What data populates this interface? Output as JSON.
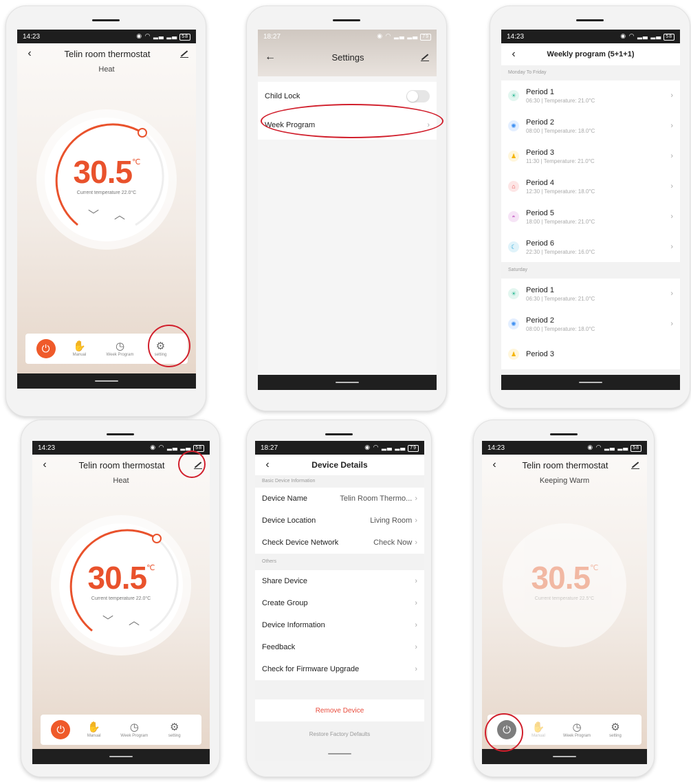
{
  "accent": "#ef5a2a",
  "highlight_color": "#d11f2c",
  "screen1": {
    "time": "14:23",
    "battery": "58",
    "title": "Telin room thermostat",
    "mode": "Heat",
    "temperature": "30.5",
    "unit": "℃",
    "current_temp": "Current temperature 22.0°C",
    "nav": [
      "Manual",
      "Week Program",
      "setting"
    ]
  },
  "screen2": {
    "time": "18:27",
    "battery": "79",
    "title": "Settings",
    "rows": [
      "Child Lock",
      "Week Program"
    ]
  },
  "screen3": {
    "time": "14:23",
    "battery": "58",
    "title": "Weekly program (5+1+1)",
    "sections": [
      {
        "label": "Monday To Friday",
        "periods": [
          {
            "name": "Period 1",
            "detail": "06:30  |  Temperature: 21.0°C",
            "icon": "sunrise-icon",
            "color": "#3cbf9c"
          },
          {
            "name": "Period 2",
            "detail": "08:00  |  Temperature: 18.0°C",
            "icon": "sun-icon",
            "color": "#3d8ff2"
          },
          {
            "name": "Period 3",
            "detail": "11:30  |  Temperature: 21.0°C",
            "icon": "person-icon",
            "color": "#f5b400"
          },
          {
            "name": "Period 4",
            "detail": "12:30  |  Temperature: 18.0°C",
            "icon": "home-icon",
            "color": "#e84e4e"
          },
          {
            "name": "Period 5",
            "detail": "18:00  |  Temperature: 21.0°C",
            "icon": "sunset-icon",
            "color": "#c764c7"
          },
          {
            "name": "Period 6",
            "detail": "22:30  |  Temperature: 16.0°C",
            "icon": "moon-icon",
            "color": "#30a9d8"
          }
        ]
      },
      {
        "label": "Saturday",
        "periods": [
          {
            "name": "Period 1",
            "detail": "06:30  |  Temperature: 21.0°C",
            "icon": "sunrise-icon",
            "color": "#3cbf9c"
          },
          {
            "name": "Period 2",
            "detail": "08:00  |  Temperature: 18.0°C",
            "icon": "sun-icon",
            "color": "#3d8ff2"
          },
          {
            "name": "Period 3",
            "detail": "",
            "icon": "person-icon",
            "color": "#f5b400"
          }
        ]
      }
    ]
  },
  "screen4": {
    "time": "14:23",
    "battery": "58",
    "title": "Telin room thermostat",
    "mode": "Heat",
    "temperature": "30.5",
    "unit": "℃",
    "current_temp": "Current temperature 22.0°C",
    "nav": [
      "Manual",
      "Week Program",
      "setting"
    ]
  },
  "screen5": {
    "time": "18:27",
    "battery": "79",
    "title": "Device Details",
    "section1": "Basic Device Information",
    "basic_rows": [
      {
        "label": "Device Name",
        "value": "Telin Room Thermo..."
      },
      {
        "label": "Device Location",
        "value": "Living Room"
      },
      {
        "label": "Check Device Network",
        "value": "Check Now"
      }
    ],
    "section2": "Others",
    "other_rows": [
      "Share Device",
      "Create Group",
      "Device Information",
      "Feedback",
      "Check for Firmware Upgrade"
    ],
    "remove": "Remove Device",
    "restore": "Restore Factory Defaults"
  },
  "screen6": {
    "time": "14:23",
    "battery": "58",
    "title": "Telin room thermostat",
    "mode": "Keeping Warm",
    "temperature": "30.5",
    "unit": "℃",
    "current_temp": "Current temperature 22.5°C",
    "nav": [
      "Manual",
      "Week Program",
      "setting"
    ]
  }
}
